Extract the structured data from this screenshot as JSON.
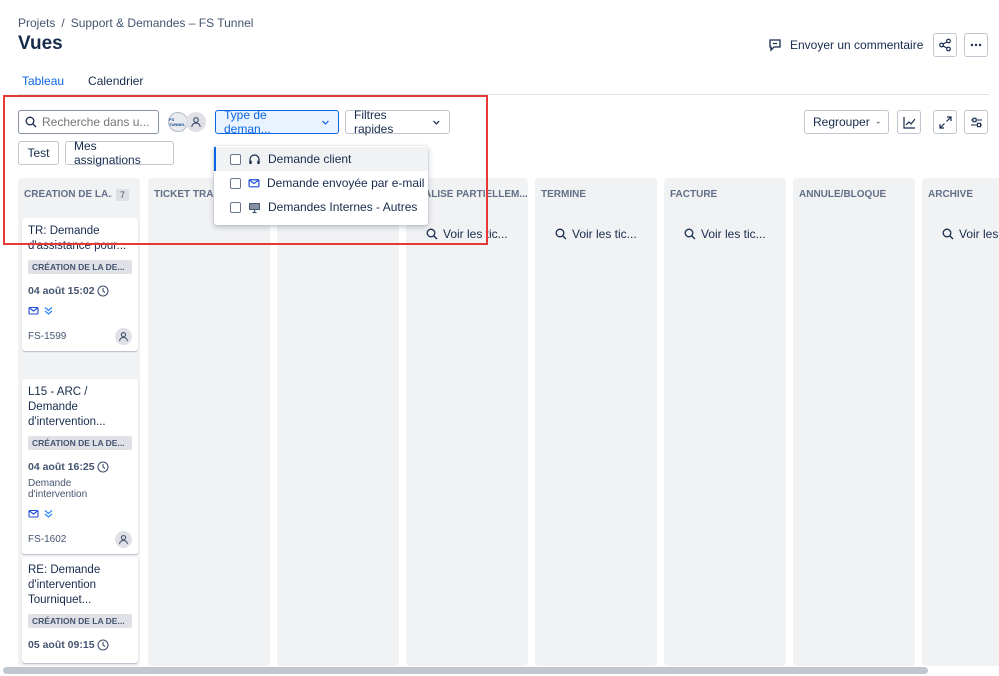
{
  "breadcrumb": {
    "root": "Projets",
    "sep": "/",
    "project": "Support & Demandes – FS Tunnel"
  },
  "page": {
    "title": "Vues"
  },
  "header": {
    "feedback_label": "Envoyer un commentaire"
  },
  "tabs": [
    {
      "label": "Tableau",
      "active": true
    },
    {
      "label": "Calendrier",
      "active": false
    }
  ],
  "toolbar": {
    "search_placeholder": "Recherche dans u...",
    "avatar_logo_text": "FS TUNNEL",
    "type_filter_label": "Type de deman...",
    "quick_filters_label": "Filtres rapides",
    "group_label": "Regrouper",
    "test_label": "Test",
    "my_assignments_label": "Mes assignations"
  },
  "dropdown": {
    "items": [
      {
        "label": "Demande client",
        "icon": "headset-icon"
      },
      {
        "label": "Demande envoyée par e-mail",
        "icon": "mail-icon"
      },
      {
        "label": "Demandes Internes - Autres",
        "icon": "monitor-icon"
      }
    ]
  },
  "columns": [
    {
      "title": "CRÉATION DE LA...",
      "count": "7"
    },
    {
      "title": "TICKET TRAI"
    },
    {
      "title": ""
    },
    {
      "title": "ALISÉ PARTIELLEM...",
      "search": "Voir les tic..."
    },
    {
      "title": "TERMINÉ",
      "search": "Voir les tic..."
    },
    {
      "title": "FACTURÉ",
      "search": "Voir les tic..."
    },
    {
      "title": "ANNULÉ/BLOQUÉ"
    },
    {
      "title": "ARCHIVÉ",
      "search": "Voir les"
    }
  ],
  "cards": [
    {
      "title": "TR: Demande d'assistance pour...",
      "status": "CRÉATION DE LA DE...",
      "date": "04 août 15:02",
      "key": "FS-1599"
    },
    {
      "title": "L15 - ARC / Demande d'intervention...",
      "status": "CRÉATION DE LA DE...",
      "date": "04 août 16:25",
      "desc": "Demande d'intervention",
      "key": "FS-1602"
    },
    {
      "title": "RE: Demande d'intervention Tourniquet...",
      "status": "CRÉATION DE LA DE...",
      "date": "05 août 09:15"
    }
  ],
  "colors": {
    "accent": "#0c66e4",
    "highlight_box": "#e53935",
    "column_bg": "#f1f2f4"
  }
}
